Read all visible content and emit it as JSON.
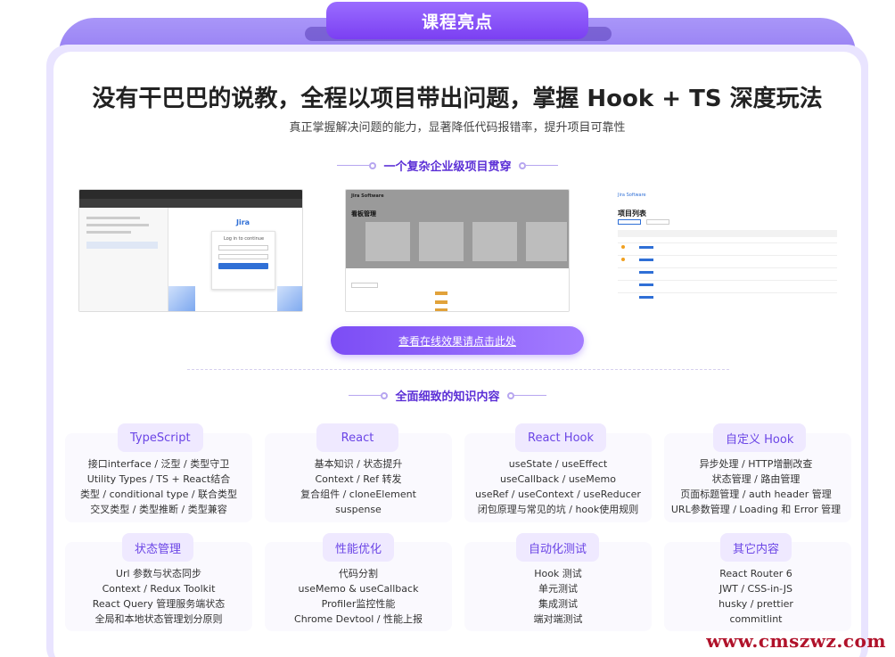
{
  "header": {
    "tab_title": "课程亮点",
    "headline": "没有干巴巴的说教，全程以项目带出问题，掌握 Hook + TS 深度玩法",
    "subline": "真正掌握解决问题的能力，显著降低代码报错率，提升项目可靠性"
  },
  "project_section": {
    "title": "一个复杂企业级项目贯穿",
    "cta_label": "查看在线效果请点击此处",
    "screens": {
      "login": {
        "brand": "Jira",
        "form_title": "Log in to continue",
        "submit": "登录"
      },
      "board": {
        "brand": "Jira Software",
        "title": "看板管理",
        "nav_items": [
          "项目",
          "用户"
        ]
      },
      "list": {
        "brand": "Jira Software",
        "title": "项目列表",
        "nav_items": [
          "项目",
          "用户"
        ]
      }
    }
  },
  "knowledge_section": {
    "title": "全面细致的知识内容",
    "cards": [
      {
        "title": "TypeScript",
        "lines": [
          "接口interface / 泛型 / 类型守卫",
          "Utility Types / TS + React结合",
          "类型 / conditional type / 联合类型",
          "交叉类型 / 类型推断 / 类型兼容"
        ]
      },
      {
        "title": "React",
        "lines": [
          "基本知识 / 状态提升",
          "Context / Ref 转发",
          "复合组件 / cloneElement",
          "suspense"
        ]
      },
      {
        "title": "React Hook",
        "lines": [
          "useState / useEffect",
          "useCallback / useMemo",
          "useRef / useContext / useReducer",
          "闭包原理与常见的坑 / hook使用规则"
        ]
      },
      {
        "title": "自定义 Hook",
        "lines": [
          "异步处理 / HTTP增删改查",
          "状态管理 / 路由管理",
          "页面标题管理 / auth header 管理",
          "URL参数管理 / Loading 和 Error 管理"
        ]
      },
      {
        "title": "状态管理",
        "lines": [
          "Url 参数与状态同步",
          "Context / Redux Toolkit",
          "React Query 管理服务端状态",
          "全局和本地状态管理划分原则"
        ]
      },
      {
        "title": "性能优化",
        "lines": [
          "代码分割",
          "useMemo & useCallback",
          "Profiler监控性能",
          "Chrome Devtool / 性能上报"
        ]
      },
      {
        "title": "自动化测试",
        "lines": [
          "Hook 测试",
          "单元测试",
          "集成测试",
          "端对端测试"
        ]
      },
      {
        "title": "其它内容",
        "lines": [
          "React Router 6",
          "JWT / CSS-in-JS",
          "husky / prettier",
          "commitlint"
        ]
      }
    ]
  },
  "watermark": "www.cmszwz.com",
  "colors": {
    "accent": "#7b3ff2",
    "band": "#8a70f0",
    "badge_bg": "#efe9ff",
    "badge_text": "#6b45e6",
    "watermark": "#b0122a"
  }
}
